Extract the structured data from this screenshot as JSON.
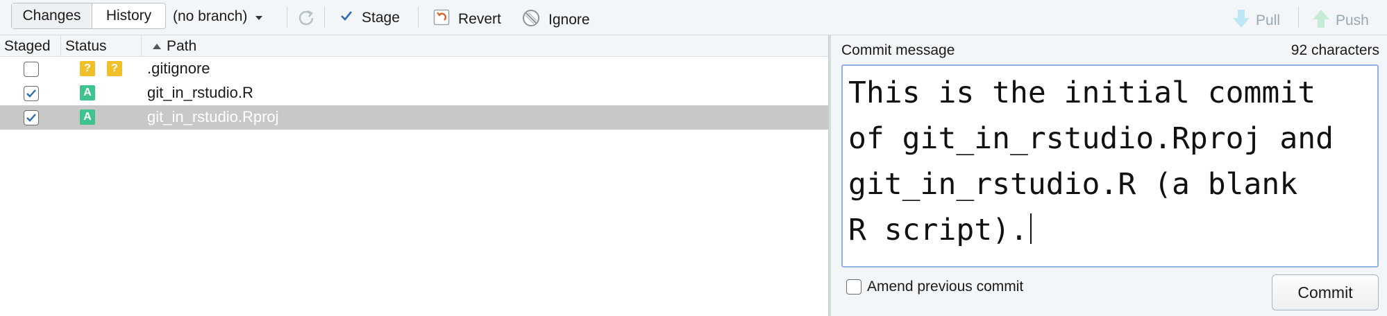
{
  "toolbar": {
    "tabs": [
      {
        "label": "Changes",
        "active": true
      },
      {
        "label": "History",
        "active": false
      }
    ],
    "branch_label": "(no branch)",
    "stage_label": "Stage",
    "revert_label": "Revert",
    "ignore_label": "Ignore",
    "pull_label": "Pull",
    "push_label": "Push"
  },
  "table": {
    "columns": [
      "Staged",
      "Status",
      "Path"
    ],
    "sort_column": "Path",
    "sort_direction": "ascending",
    "rows": [
      {
        "staged": false,
        "status": [
          "?",
          "?"
        ],
        "path": ".gitignore",
        "selected": false
      },
      {
        "staged": true,
        "status": [
          "A"
        ],
        "path": "git_in_rstudio.R",
        "selected": false
      },
      {
        "staged": true,
        "status": [
          "A"
        ],
        "path": "git_in_rstudio.Rproj",
        "selected": true
      }
    ]
  },
  "commit": {
    "label": "Commit message",
    "char_count": "92 characters",
    "message": "This is the initial commit\nof git_in_rstudio.Rproj and\ngit_in_rstudio.R (a blank\nR script).",
    "amend_label": "Amend previous commit",
    "amend_checked": false,
    "button_label": "Commit"
  },
  "colors": {
    "status_untracked": "#f0c02a",
    "status_added": "#3fc38f",
    "selected_row": "#c8c8c8",
    "focus_border": "#8fb2e0",
    "checkbox_check": "#2b6cb0",
    "pull_push_disabled": "#9aa8b2",
    "revert_icon": "#d9622b"
  },
  "icons": {
    "refresh": "refresh-icon",
    "stage": "stage-check-icon",
    "revert": "revert-icon",
    "ignore": "ignore-icon",
    "pull": "pull-arrow-down-icon",
    "push": "push-arrow-up-icon"
  }
}
